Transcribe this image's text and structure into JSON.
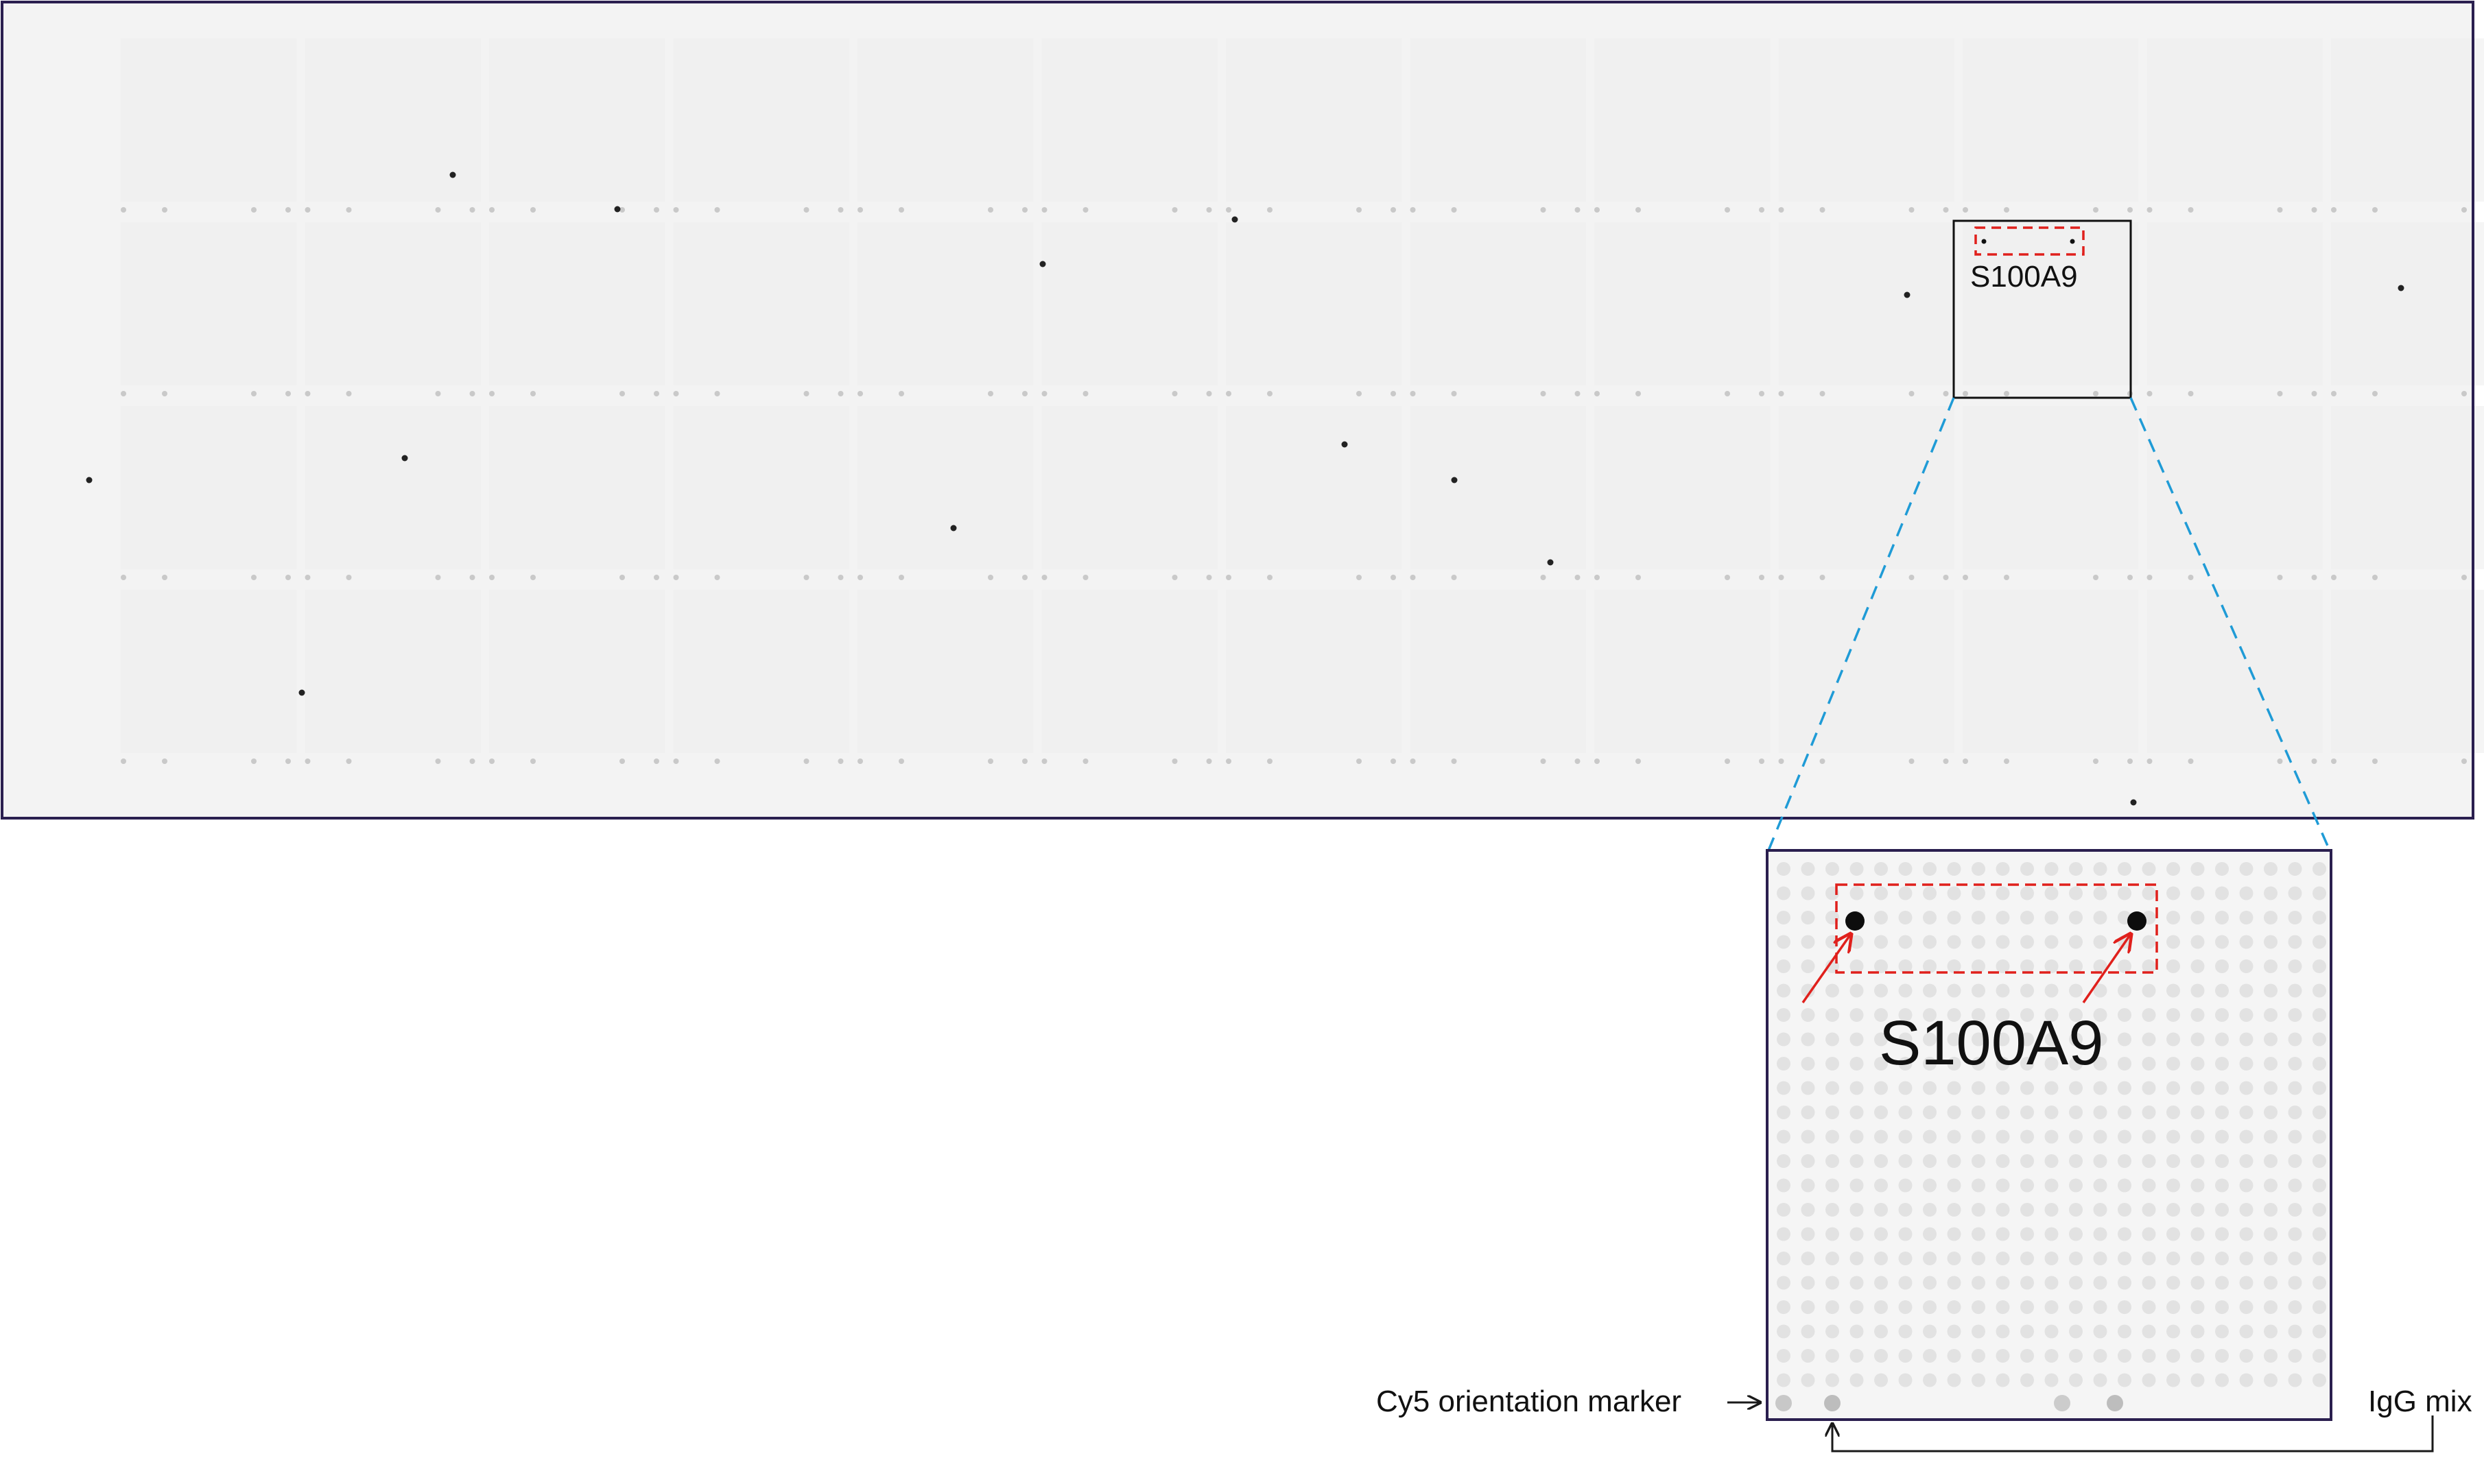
{
  "figure": {
    "protein_label_small": "S100A9",
    "protein_label_large": "S100A9",
    "left_annotation": "Cy5 orientation marker",
    "right_annotation": "IgG mix"
  },
  "colors": {
    "frame": "#2a1f4f",
    "slide_background": "#f3f3f3",
    "spot_faint": "#e3e3e3",
    "spot_medium": "#c8c8c8",
    "spot_strong": "#0d0d0d",
    "highlight_box": "#e0201c",
    "arrow": "#e0201c",
    "zoom_guides": "#1f9bd6",
    "annotation_line": "#1a1a1a"
  },
  "icons": {
    "zoom_region_marker": "rectangle-outline",
    "highlight_marker": "dashed-rectangle",
    "pointer": "arrow-icon"
  }
}
